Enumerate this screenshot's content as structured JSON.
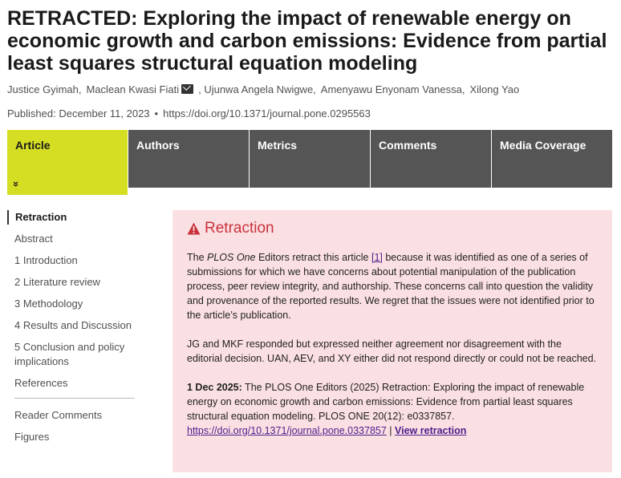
{
  "article": {
    "title": "RETRACTED: Exploring the impact of renewable energy on economic growth and carbon emissions: Evidence from partial least squares structural equation modeling",
    "authors": [
      {
        "name": "Justice Gyimah,",
        "mail": false
      },
      {
        "name": "Maclean Kwasi Fiati",
        "mail": true
      },
      {
        "name": ", Ujunwa Angela Nwigwe,",
        "mail": false
      },
      {
        "name": "Amenyawu Enyonam Vanessa,",
        "mail": false
      },
      {
        "name": "Xilong Yao",
        "mail": false
      }
    ],
    "published": "Published: December 11, 2023",
    "bullet": "•",
    "doi": "https://doi.org/10.1371/journal.pone.0295563"
  },
  "tabs": [
    "Article",
    "Authors",
    "Metrics",
    "Comments",
    "Media Coverage"
  ],
  "tab_chevron": "»",
  "nav": {
    "items": [
      "Retraction",
      "Abstract",
      "1 Introduction",
      "2 Literature review",
      "3 Methodology",
      "4 Results and Discussion",
      "5 Conclusion and policy implications",
      "References"
    ],
    "extra": [
      "Reader Comments",
      "Figures"
    ]
  },
  "retraction": {
    "heading": "Retraction",
    "p1_a": "The ",
    "p1_journal": "PLOS One",
    "p1_b": " Editors retract this article ",
    "p1_ref": "[1]",
    "p1_c": " because it was identified as one of a series of submissions for which we have concerns about potential manipulation of the publication process, peer review integrity, and authorship. These concerns call into question the validity and provenance of the reported results. We regret that the issues were not identified prior to the article’s publication.",
    "p2": "JG and MKF responded but expressed neither agreement nor disagreement with the editorial decision. UAN, AEV, and XY either did not respond directly or could not be reached.",
    "p3_date": "1 Dec 2025:",
    "p3_text": " The PLOS One Editors (2025) Retraction: Exploring the impact of renewable energy on economic growth and carbon emissions: Evidence from partial least squares structural equation modeling. PLOS ONE 20(12): e0337857.",
    "p3_doi": "https://doi.org/10.1371/journal.pone.0337857",
    "p3_sep": " | ",
    "p3_view": "View retraction"
  },
  "colors": {
    "accent_tab": "#d6de23",
    "tab_bg": "#555555",
    "notice_bg": "#fbe0e3",
    "notice_heading": "#c8313a",
    "link": "#4b1d8c"
  }
}
